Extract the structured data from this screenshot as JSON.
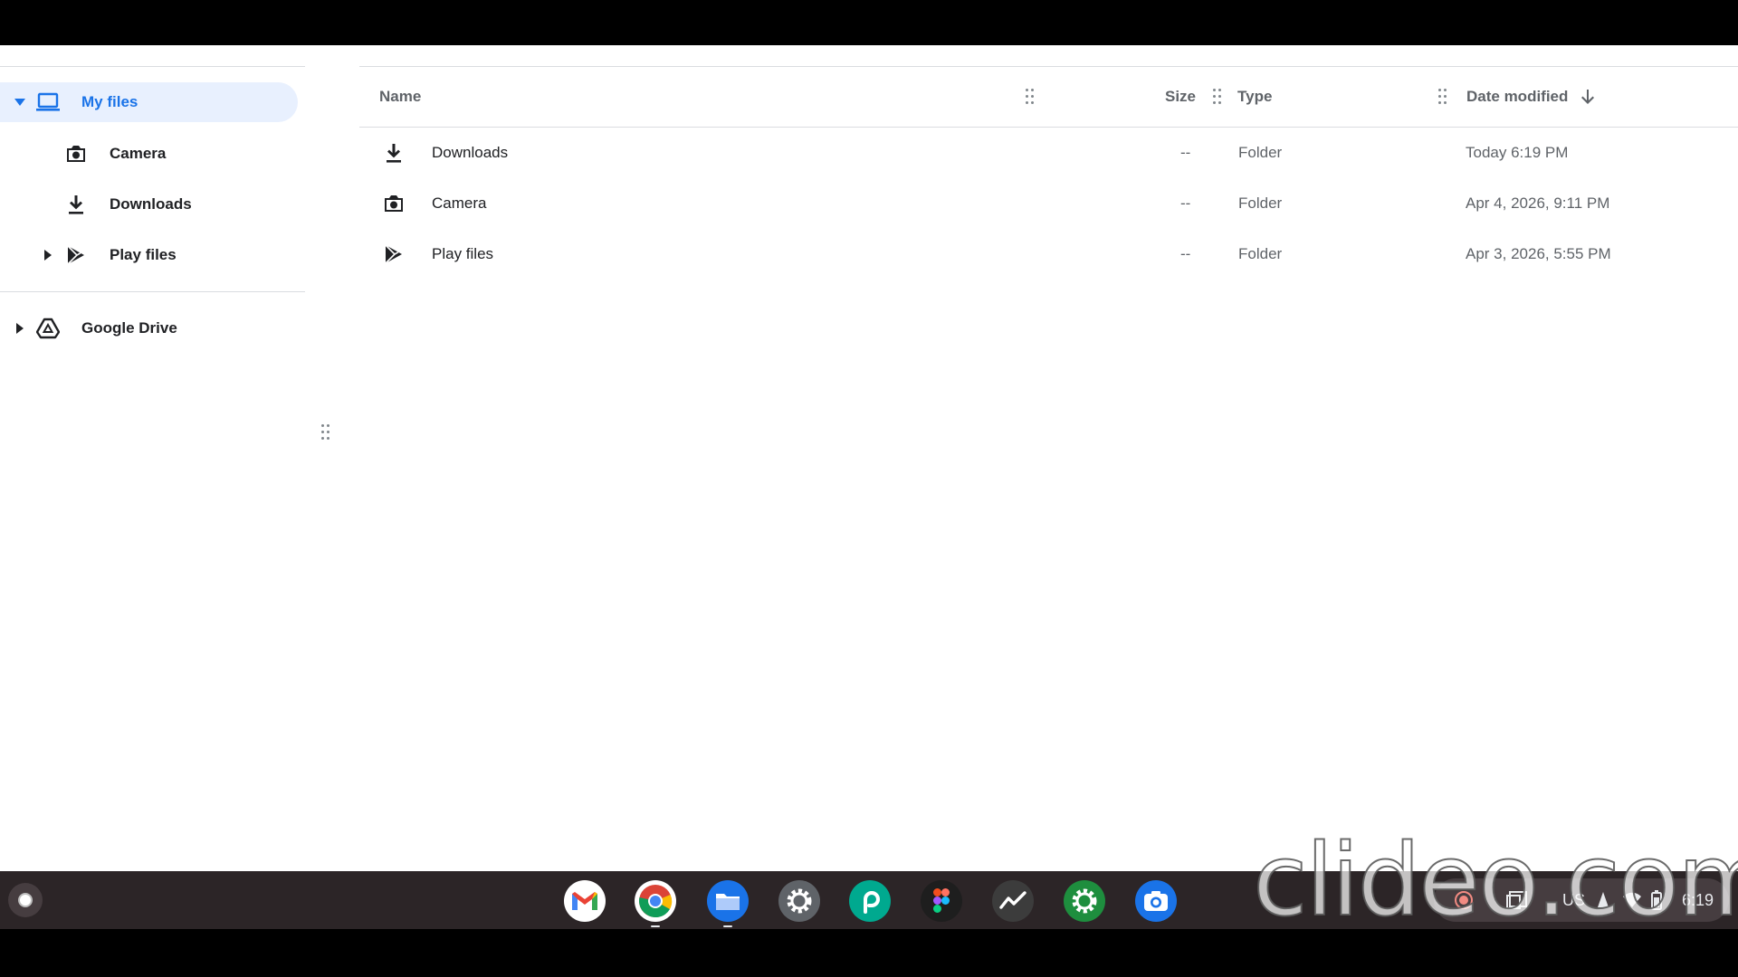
{
  "sidebar": {
    "items": [
      {
        "label": "My files",
        "icon": "laptop-icon",
        "selected": true,
        "expanded": true
      },
      {
        "label": "Camera",
        "icon": "camera-folder-icon"
      },
      {
        "label": "Downloads",
        "icon": "download-icon"
      },
      {
        "label": "Play files",
        "icon": "play-files-icon",
        "expandable": true
      },
      {
        "label": "Google Drive",
        "icon": "google-drive-icon",
        "expandable": true
      }
    ]
  },
  "file_list": {
    "columns": {
      "name": "Name",
      "size": "Size",
      "type": "Type",
      "date_modified": "Date modified",
      "sort": "descending"
    },
    "rows": [
      {
        "name": "Downloads",
        "icon": "download-icon",
        "size": "--",
        "type": "Folder",
        "date": "Today 6:19 PM"
      },
      {
        "name": "Camera",
        "icon": "camera-folder-icon",
        "size": "--",
        "type": "Folder",
        "date": "Apr 4, 2026, 9:11 PM"
      },
      {
        "name": "Play files",
        "icon": "play-files-icon",
        "size": "--",
        "type": "Folder",
        "date": "Apr 3, 2026, 5:55 PM"
      }
    ]
  },
  "shelf": {
    "apps": [
      "gmail-icon",
      "chrome-icon",
      "files-app-icon",
      "settings-icon",
      "picsart-icon",
      "figma-icon",
      "stocks-icon",
      "settings-green-icon",
      "camera-app-icon"
    ],
    "tray": {
      "keyboard_layout": "US",
      "time": "6:19"
    }
  },
  "watermark": "clideo.com",
  "colors": {
    "accent": "#1a73e8",
    "selected_bg": "#e8f0fe",
    "shelf_bg": "#2c2527"
  }
}
